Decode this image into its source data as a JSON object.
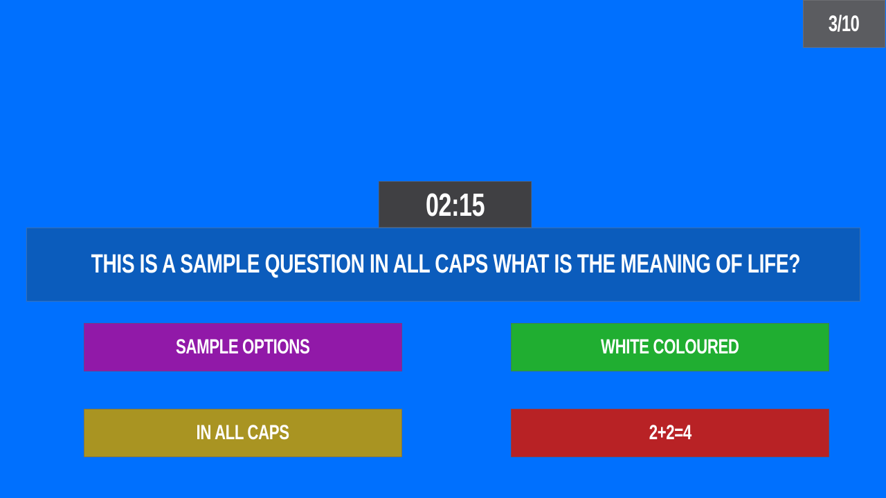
{
  "progress": {
    "label": "3/10",
    "current": 3,
    "total": 10
  },
  "timer": {
    "label": "02:15"
  },
  "question": {
    "text": "THIS IS A SAMPLE QUESTION IN ALL CAPS WHAT IS THE MEANING OF LIFE?"
  },
  "options": [
    {
      "label": "SAMPLE OPTIONS",
      "color": "#9119a8"
    },
    {
      "label": "WHITE COLOURED",
      "color": "#20ae31"
    },
    {
      "label": "IN ALL CAPS",
      "color": "#a99422"
    },
    {
      "label": "2+2=4",
      "color": "#b82225"
    }
  ],
  "colors": {
    "background": "#0070fe",
    "question_panel": "#0b5cbc",
    "timer_panel": "#404043",
    "counter_panel": "#5b5c60",
    "text": "#ffffff"
  }
}
